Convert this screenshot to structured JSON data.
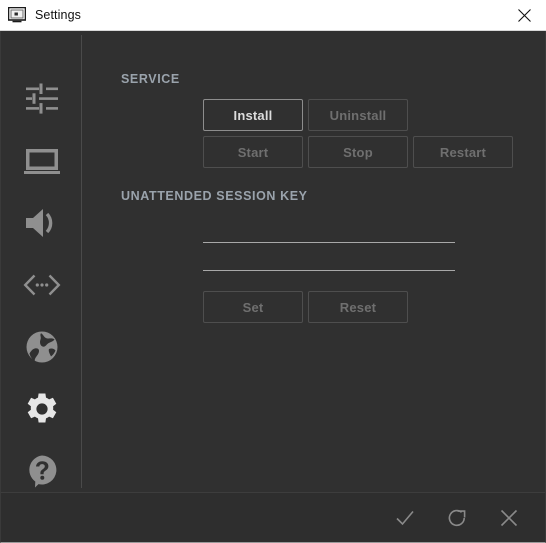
{
  "window": {
    "title": "Settings",
    "title_icon": "display-settings-icon",
    "close_label": "✕",
    "background_color": "#303030",
    "titlebar_color": "#ffffff"
  },
  "sidebar": {
    "items": [
      {
        "icon": "sliders-icon",
        "name": "general",
        "active": false
      },
      {
        "icon": "display-icon",
        "name": "display",
        "active": false
      },
      {
        "icon": "speaker-icon",
        "name": "audio",
        "active": false
      },
      {
        "icon": "code-icon",
        "name": "advanced",
        "active": false
      },
      {
        "icon": "globe-icon",
        "name": "network",
        "active": false
      },
      {
        "icon": "gear-icon",
        "name": "settings",
        "active": true
      },
      {
        "icon": "help-icon",
        "name": "help",
        "active": false
      }
    ]
  },
  "content": {
    "service": {
      "heading": "SERVICE",
      "buttons": [
        {
          "label": "Install",
          "enabled": true
        },
        {
          "label": "Uninstall",
          "enabled": false
        },
        {
          "label": "Start",
          "enabled": false
        },
        {
          "label": "Stop",
          "enabled": false
        },
        {
          "label": "Restart",
          "enabled": false
        }
      ]
    },
    "session_key": {
      "heading": "UNATTENDED SESSION KEY",
      "field_1": {
        "value": "",
        "placeholder": ""
      },
      "field_2": {
        "value": "",
        "placeholder": ""
      },
      "buttons": [
        {
          "label": "Set",
          "enabled": false
        },
        {
          "label": "Reset",
          "enabled": false
        }
      ]
    }
  },
  "footer": {
    "actions": [
      {
        "icon": "check-icon",
        "name": "apply"
      },
      {
        "icon": "refresh-icon",
        "name": "reload"
      },
      {
        "icon": "close-icon",
        "name": "cancel"
      }
    ]
  },
  "colors": {
    "accent_text": "#9aa3ac",
    "enabled_text": "#dcdcdc",
    "disabled_text": "#6f6f6f",
    "border": "#4e4e4e",
    "border_enabled": "#8d8d8d"
  }
}
